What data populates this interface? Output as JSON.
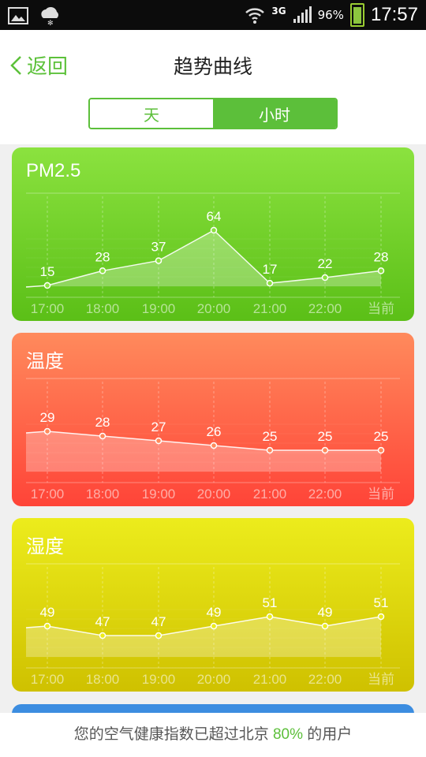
{
  "status": {
    "network": "3G",
    "battery": "96%",
    "time": "17:57",
    "icons": [
      "image-icon",
      "weather-cloud-icon",
      "wifi-icon",
      "signal-icon",
      "battery-icon"
    ]
  },
  "header": {
    "back_label": "返回",
    "title": "趋势曲线"
  },
  "tabs": [
    {
      "label": "天",
      "selected": false
    },
    {
      "label": "小时",
      "selected": true
    }
  ],
  "accent_color": "#5cbf3a",
  "cards": [
    {
      "title": "PM2.5",
      "colors": {
        "top": "#8be23f",
        "bottom": "#5bbf17"
      },
      "chart_data": {
        "type": "area",
        "categories": [
          "17:00",
          "18:00",
          "19:00",
          "20:00",
          "21:00",
          "22:00",
          "当前"
        ],
        "values": [
          15,
          28,
          37,
          64,
          17,
          22,
          28
        ],
        "labels": [
          "15",
          "28",
          "37",
          "64",
          "17",
          "22",
          "28"
        ]
      }
    },
    {
      "title": "温度",
      "colors": {
        "top": "#ff8a5c",
        "bottom": "#ff4438"
      },
      "chart_data": {
        "type": "area",
        "categories": [
          "17:00",
          "18:00",
          "19:00",
          "20:00",
          "21:00",
          "22:00",
          "当前"
        ],
        "values": [
          29,
          28,
          27,
          26,
          25,
          25,
          25
        ],
        "labels": [
          "29",
          "28",
          "27",
          "26",
          "25",
          "25",
          "25"
        ]
      }
    },
    {
      "title": "湿度",
      "colors": {
        "top": "#ecec1c",
        "bottom": "#cfc100"
      },
      "chart_data": {
        "type": "area",
        "categories": [
          "17:00",
          "18:00",
          "19:00",
          "20:00",
          "21:00",
          "22:00",
          "当前"
        ],
        "values": [
          49,
          47,
          47,
          49,
          51,
          49,
          51
        ],
        "labels": [
          "49",
          "47",
          "47",
          "49",
          "51",
          "49",
          "51"
        ]
      }
    }
  ],
  "footer": {
    "prefix": "您的空气健康指数已超过北京",
    "percent": "80%",
    "suffix": "的用户"
  }
}
